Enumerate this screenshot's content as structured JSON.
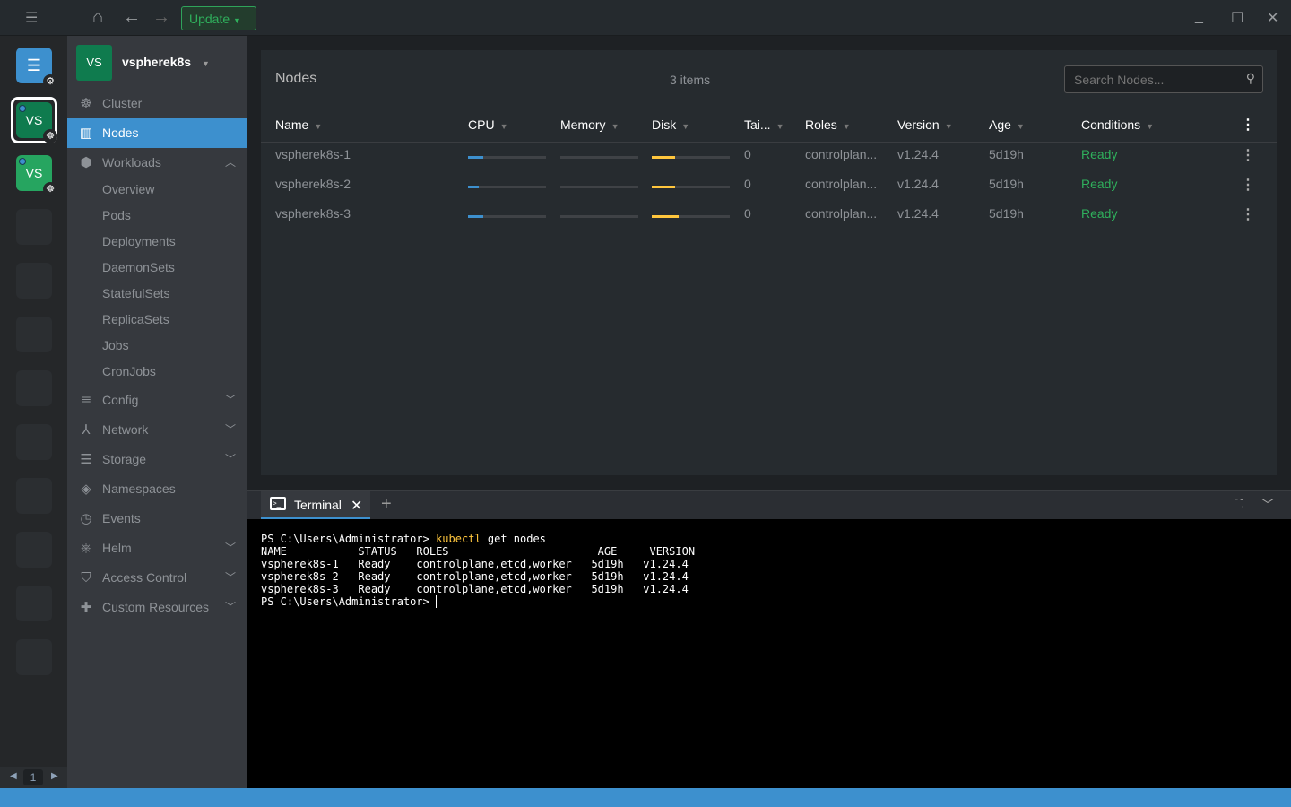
{
  "topbar": {
    "update_label": "Update"
  },
  "hotbar": {
    "items": [
      {
        "label": "VS"
      },
      {
        "label": "VS"
      }
    ],
    "page": "1"
  },
  "sidebar": {
    "cluster_initials": "VS",
    "cluster_name": "vspherek8s",
    "items": {
      "cluster": "Cluster",
      "nodes": "Nodes",
      "workloads": "Workloads",
      "config": "Config",
      "network": "Network",
      "storage": "Storage",
      "namespaces": "Namespaces",
      "events": "Events",
      "helm": "Helm",
      "access": "Access Control",
      "custom": "Custom Resources"
    },
    "workload_subitems": [
      "Overview",
      "Pods",
      "Deployments",
      "DaemonSets",
      "StatefulSets",
      "ReplicaSets",
      "Jobs",
      "CronJobs"
    ]
  },
  "nodes": {
    "title": "Nodes",
    "count": "3 items",
    "search_placeholder": "Search Nodes...",
    "columns": [
      "Name",
      "CPU",
      "Memory",
      "Disk",
      "Tai...",
      "Roles",
      "Version",
      "Age",
      "Conditions"
    ],
    "rows": [
      {
        "name": "vspherek8s-1",
        "cpu": 0.2,
        "memory": 0,
        "disk": 0.3,
        "taints": "0",
        "roles": "controlplan...",
        "version": "v1.24.4",
        "age": "5d19h",
        "conditions": "Ready"
      },
      {
        "name": "vspherek8s-2",
        "cpu": 0.14,
        "memory": 0,
        "disk": 0.3,
        "taints": "0",
        "roles": "controlplan...",
        "version": "v1.24.4",
        "age": "5d19h",
        "conditions": "Ready"
      },
      {
        "name": "vspherek8s-3",
        "cpu": 0.2,
        "memory": 0,
        "disk": 0.35,
        "taints": "0",
        "roles": "controlplan...",
        "version": "v1.24.4",
        "age": "5d19h",
        "conditions": "Ready"
      }
    ]
  },
  "dock": {
    "tab_label": "Terminal"
  },
  "terminal": {
    "prompt": "PS C:\\Users\\Administrator> ",
    "command": "kubectl",
    "args": " get nodes",
    "lines": [
      "NAME           STATUS   ROLES                       AGE     VERSION",
      "vspherek8s-1   Ready    controlplane,etcd,worker   5d19h   v1.24.4",
      "vspherek8s-2   Ready    controlplane,etcd,worker   5d19h   v1.24.4",
      "vspherek8s-3   Ready    controlplane,etcd,worker   5d19h   v1.24.4"
    ],
    "last_prompt": "PS C:\\Users\\Administrator> "
  },
  "colors": {
    "accent": "#3d90ce",
    "cluster": "#0f7b4e",
    "ready": "#2fb05c",
    "cpu": "#3d90ce",
    "disk": "#ffc63d"
  }
}
